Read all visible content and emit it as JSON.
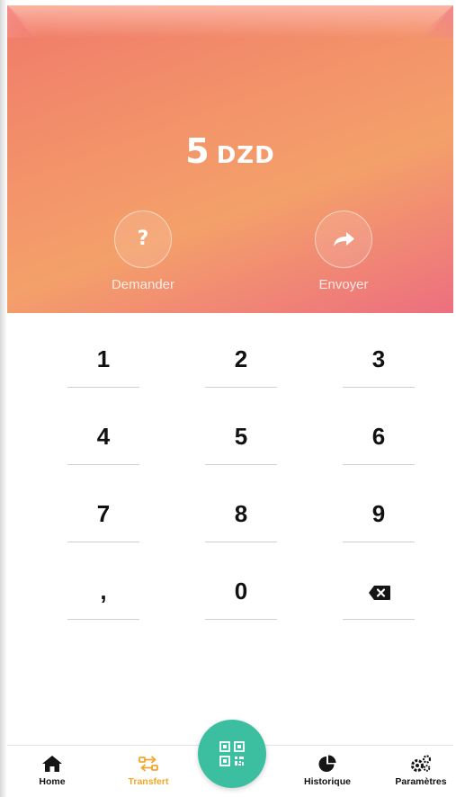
{
  "amount": {
    "value": "5",
    "currency": "DZD"
  },
  "actions": {
    "request_label": "Demander",
    "send_label": "Envoyer",
    "request_icon": "question-icon",
    "send_icon": "forward-arrow-icon"
  },
  "keypad": {
    "keys": [
      "1",
      "2",
      "3",
      "4",
      "5",
      "6",
      "7",
      "8",
      "9",
      ",",
      "0"
    ],
    "backspace_icon": "backspace-icon"
  },
  "nav": {
    "home": "Home",
    "transfert": "Transfert",
    "historique": "Historique",
    "parametres": "Paramètres",
    "active": "transfert",
    "scan_icon": "qr-code-icon"
  },
  "colors": {
    "header_start": "#f07a6a",
    "header_end": "#ec6f7f",
    "accent_orange": "#f2a62a",
    "fab_green": "#3cbfa0"
  }
}
